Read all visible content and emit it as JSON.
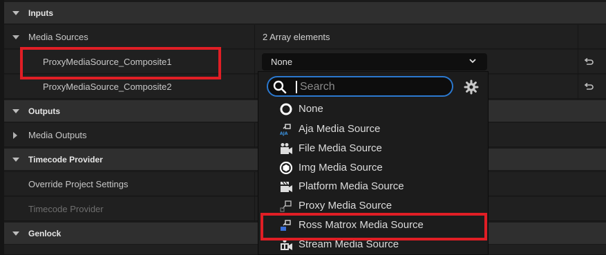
{
  "sections": {
    "inputs": "Inputs",
    "outputs": "Outputs",
    "timecode": "Timecode Provider",
    "genlock": "Genlock"
  },
  "rows": {
    "media_sources": {
      "label": "Media Sources",
      "value": "2 Array elements"
    },
    "proxy1": {
      "label": "ProxyMediaSource_Composite1",
      "value": "None"
    },
    "proxy2": {
      "label": "ProxyMediaSource_Composite2"
    },
    "media_outputs": {
      "label": "Media Outputs"
    },
    "override": {
      "label": "Override Project Settings"
    },
    "timecode_provider": {
      "label": "Timecode Provider"
    }
  },
  "dropdown": {
    "search_placeholder": "Search",
    "items": [
      {
        "label": "None",
        "icon": "none-circle-icon"
      },
      {
        "label": "Aja Media Source",
        "icon": "aja-icon"
      },
      {
        "label": "File Media Source",
        "icon": "film-icon"
      },
      {
        "label": "Img Media Source",
        "icon": "img-icon"
      },
      {
        "label": "Platform Media Source",
        "icon": "platform-icon"
      },
      {
        "label": "Proxy Media Source",
        "icon": "proxy-icon"
      },
      {
        "label": "Ross Matrox Media Source",
        "icon": "ross-icon"
      },
      {
        "label": "Stream Media Source",
        "icon": "stream-icon"
      }
    ]
  },
  "colors": {
    "highlight": "#e01e25",
    "search_border": "#2b79d0"
  }
}
